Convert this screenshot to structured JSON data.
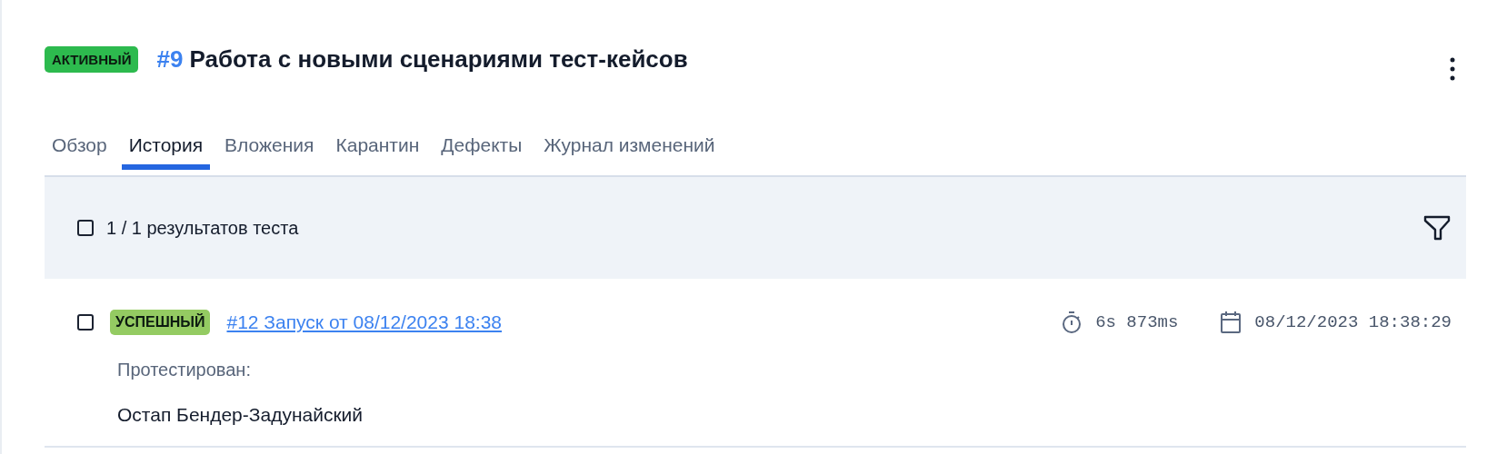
{
  "status": {
    "label": "АКТИВНЫЙ",
    "kind": "active"
  },
  "case": {
    "number": "#9",
    "title": "Работа с новыми сценариями тест-кейсов"
  },
  "tabs": [
    {
      "label": "Обзор",
      "selected": false
    },
    {
      "label": "История",
      "selected": true
    },
    {
      "label": "Вложения",
      "selected": false
    },
    {
      "label": "Карантин",
      "selected": false
    },
    {
      "label": "Дефекты",
      "selected": false
    },
    {
      "label": "Журнал изменений",
      "selected": false
    }
  ],
  "toolbar": {
    "checked": false,
    "count": "1 / 1 результатов теста"
  },
  "results": [
    {
      "checked": false,
      "status": {
        "label": "УСПЕШНЫЙ",
        "kind": "passed"
      },
      "link": "#12 Запуск от 08/12/2023 18:38",
      "duration": "6s 873ms",
      "date": "08/12/2023 18:38:29",
      "tested_by_label": "Протестирован:",
      "tested_by": "Остап Бендер-Задунайский"
    }
  ]
}
